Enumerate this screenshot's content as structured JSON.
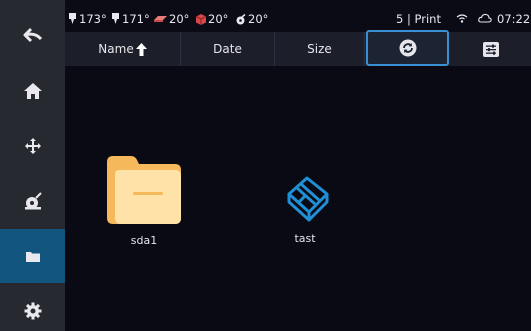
{
  "sidebar": {
    "items": [
      {
        "icon": "back-arrow-icon",
        "active": false
      },
      {
        "icon": "home-icon",
        "active": false
      },
      {
        "icon": "move-icon",
        "active": false
      },
      {
        "icon": "extrude-icon",
        "active": false
      },
      {
        "icon": "folder-icon",
        "active": true
      },
      {
        "icon": "gear-icon",
        "active": false
      }
    ]
  },
  "status": {
    "extruder1_temp": "173°",
    "extruder2_temp": "171°",
    "bed_temp": "20°",
    "chamber_temp": "20°",
    "fan_temp": "20°",
    "print_status": "5 | Print",
    "time": "07:22"
  },
  "headers": {
    "name_label": "Name",
    "date_label": "Date",
    "size_label": "Size",
    "sort_icon": "arrow-up-icon",
    "refresh_icon": "refresh-icon",
    "settings_icon": "sliders-icon"
  },
  "files": [
    {
      "name": "sda1",
      "type": "folder",
      "icon": "folder-icon"
    },
    {
      "name": "tast",
      "type": "gcode-file",
      "icon": "model-file-icon"
    }
  ],
  "colors": {
    "background": "#090a14",
    "sidebar": "#26292f",
    "sidebar_active": "#11547e",
    "folder": "#f5b85a",
    "folder_light": "#ffe2a8",
    "file_icon": "#1f8fd6",
    "refresh_border": "#3b8fd6"
  }
}
